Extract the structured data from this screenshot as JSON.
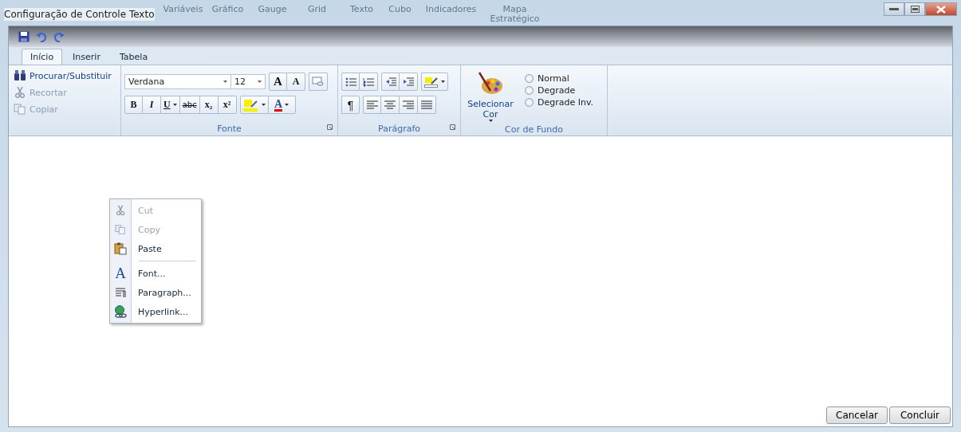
{
  "background_app": {
    "toolbar_labels": [
      "Variáveis",
      "Gráfico",
      "Gauge",
      "Grid",
      "Texto",
      "Cubo",
      "Indicadores",
      "Mapa Estratégico"
    ]
  },
  "window": {
    "title": "Configuração de Controle Texto"
  },
  "tabs": [
    {
      "label": "Início",
      "selected": true
    },
    {
      "label": "Inserir",
      "selected": false
    },
    {
      "label": "Tabela",
      "selected": false
    }
  ],
  "ribbon": {
    "clipboard": [
      {
        "label": "Procurar/Substituir",
        "disabled": false
      },
      {
        "label": "Recortar",
        "disabled": true
      },
      {
        "label": "Copiar",
        "disabled": true
      }
    ],
    "font_group": {
      "label": "Fonte",
      "font": "Verdana",
      "size": "12",
      "grow_glyph": "A",
      "shrink_glyph": "A",
      "format_buttons": [
        "B",
        "I",
        "U",
        "abc",
        "x₂",
        "x²"
      ],
      "color_glyph": "A"
    },
    "paragraph_group": {
      "label": "Parágrafo",
      "pilcrow": "¶"
    },
    "background_group": {
      "label": "Cor de Fundo",
      "select_button": "Selecionar Cor",
      "options": [
        {
          "label": "Normal",
          "selected": false
        },
        {
          "label": "Degrade",
          "selected": false
        },
        {
          "label": "Degrade Inv.",
          "selected": false
        }
      ]
    }
  },
  "context_menu": {
    "items": [
      {
        "kind": "cut",
        "label": "Cut",
        "disabled": true
      },
      {
        "kind": "copy",
        "label": "Copy",
        "disabled": true
      },
      {
        "kind": "paste",
        "label": "Paste",
        "disabled": false
      },
      {
        "kind": "separator"
      },
      {
        "kind": "font",
        "label": "Font...",
        "glyph": "A",
        "disabled": false
      },
      {
        "kind": "paragraph",
        "label": "Paragraph...",
        "disabled": false
      },
      {
        "kind": "hyperlink",
        "label": "Hyperlink...",
        "disabled": false
      }
    ]
  },
  "buttons": [
    "Cancelar",
    "Concluir"
  ]
}
